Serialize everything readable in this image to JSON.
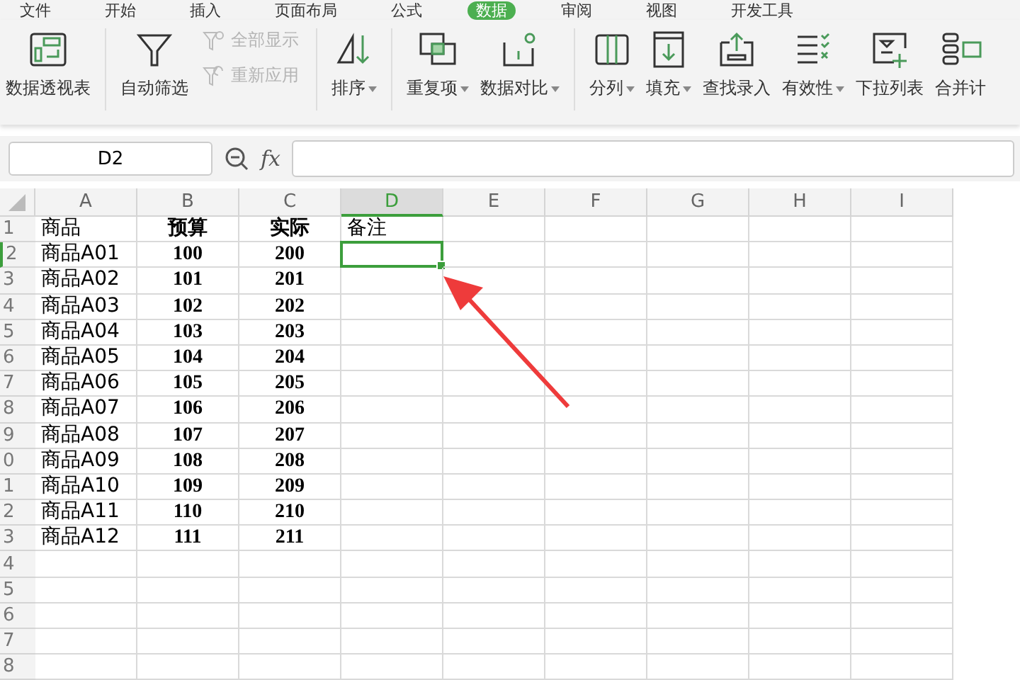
{
  "menu_tabs": [
    {
      "label": "文件",
      "selected": false
    },
    {
      "label": "开始",
      "selected": false
    },
    {
      "label": "插入",
      "selected": false
    },
    {
      "label": "页面布局",
      "selected": false
    },
    {
      "label": "公式",
      "selected": false
    },
    {
      "label": "数据",
      "selected": true
    },
    {
      "label": "审阅",
      "selected": false
    },
    {
      "label": "视图",
      "selected": false
    },
    {
      "label": "开发工具",
      "selected": false
    }
  ],
  "ribbon": [
    {
      "kind": "large",
      "label": "数据透视表",
      "dropdown": false,
      "disabled": false
    },
    {
      "kind": "large",
      "label": "自动筛选",
      "dropdown": false,
      "disabled": false
    },
    {
      "kind": "stack",
      "items": [
        {
          "label": "全部显示",
          "disabled": true
        },
        {
          "label": "重新应用",
          "disabled": true
        }
      ]
    },
    {
      "kind": "large",
      "label": "排序",
      "dropdown": true,
      "disabled": false
    },
    {
      "kind": "large",
      "label": "重复项",
      "dropdown": true,
      "disabled": false
    },
    {
      "kind": "large",
      "label": "数据对比",
      "dropdown": true,
      "disabled": false
    },
    {
      "kind": "large",
      "label": "分列",
      "dropdown": true,
      "disabled": false
    },
    {
      "kind": "large",
      "label": "填充",
      "dropdown": true,
      "disabled": false
    },
    {
      "kind": "large",
      "label": "查找录入",
      "dropdown": false,
      "disabled": false
    },
    {
      "kind": "large",
      "label": "有效性",
      "dropdown": true,
      "disabled": false
    },
    {
      "kind": "large",
      "label": "下拉列表",
      "dropdown": false,
      "disabled": false
    },
    {
      "kind": "large",
      "label": "合并计",
      "dropdown": false,
      "disabled": false
    }
  ],
  "name_box": "D2",
  "function_label": "fx",
  "columns": [
    {
      "label": "A",
      "selected": false,
      "bold": false
    },
    {
      "label": "B",
      "selected": false,
      "bold": true
    },
    {
      "label": "C",
      "selected": false,
      "bold": true
    },
    {
      "label": "D",
      "selected": true,
      "bold": false
    },
    {
      "label": "E",
      "selected": false,
      "bold": false
    },
    {
      "label": "F",
      "selected": false,
      "bold": false
    },
    {
      "label": "G",
      "selected": false,
      "bold": false
    },
    {
      "label": "H",
      "selected": false,
      "bold": false
    },
    {
      "label": "I",
      "selected": false,
      "bold": false
    }
  ],
  "rows": [
    {
      "number": "1",
      "selected": false,
      "cells": [
        "商品",
        "预算",
        "实际",
        "备注"
      ]
    },
    {
      "number": "2",
      "selected": true,
      "cells": [
        "商品A01",
        "100",
        "200",
        ""
      ]
    },
    {
      "number": "3",
      "selected": false,
      "cells": [
        "商品A02",
        "101",
        "201",
        ""
      ]
    },
    {
      "number": "4",
      "selected": false,
      "cells": [
        "商品A03",
        "102",
        "202",
        ""
      ]
    },
    {
      "number": "5",
      "selected": false,
      "cells": [
        "商品A04",
        "103",
        "203",
        ""
      ]
    },
    {
      "number": "6",
      "selected": false,
      "cells": [
        "商品A05",
        "104",
        "204",
        ""
      ]
    },
    {
      "number": "7",
      "selected": false,
      "cells": [
        "商品A06",
        "105",
        "205",
        ""
      ]
    },
    {
      "number": "8",
      "selected": false,
      "cells": [
        "商品A07",
        "106",
        "206",
        ""
      ]
    },
    {
      "number": "9",
      "selected": false,
      "cells": [
        "商品A08",
        "107",
        "207",
        ""
      ]
    },
    {
      "number": "0",
      "selected": false,
      "cells": [
        "商品A09",
        "108",
        "208",
        ""
      ]
    },
    {
      "number": "1",
      "selected": false,
      "cells": [
        "商品A10",
        "109",
        "209",
        ""
      ]
    },
    {
      "number": "2",
      "selected": false,
      "cells": [
        "商品A11",
        "110",
        "210",
        ""
      ]
    },
    {
      "number": "3",
      "selected": false,
      "cells": [
        "商品A12",
        "111",
        "211",
        ""
      ]
    },
    {
      "number": "4",
      "selected": false,
      "cells": []
    },
    {
      "number": "5",
      "selected": false,
      "cells": []
    },
    {
      "number": "6",
      "selected": false,
      "cells": []
    },
    {
      "number": "7",
      "selected": false,
      "cells": []
    },
    {
      "number": "8",
      "selected": false,
      "cells": []
    }
  ]
}
